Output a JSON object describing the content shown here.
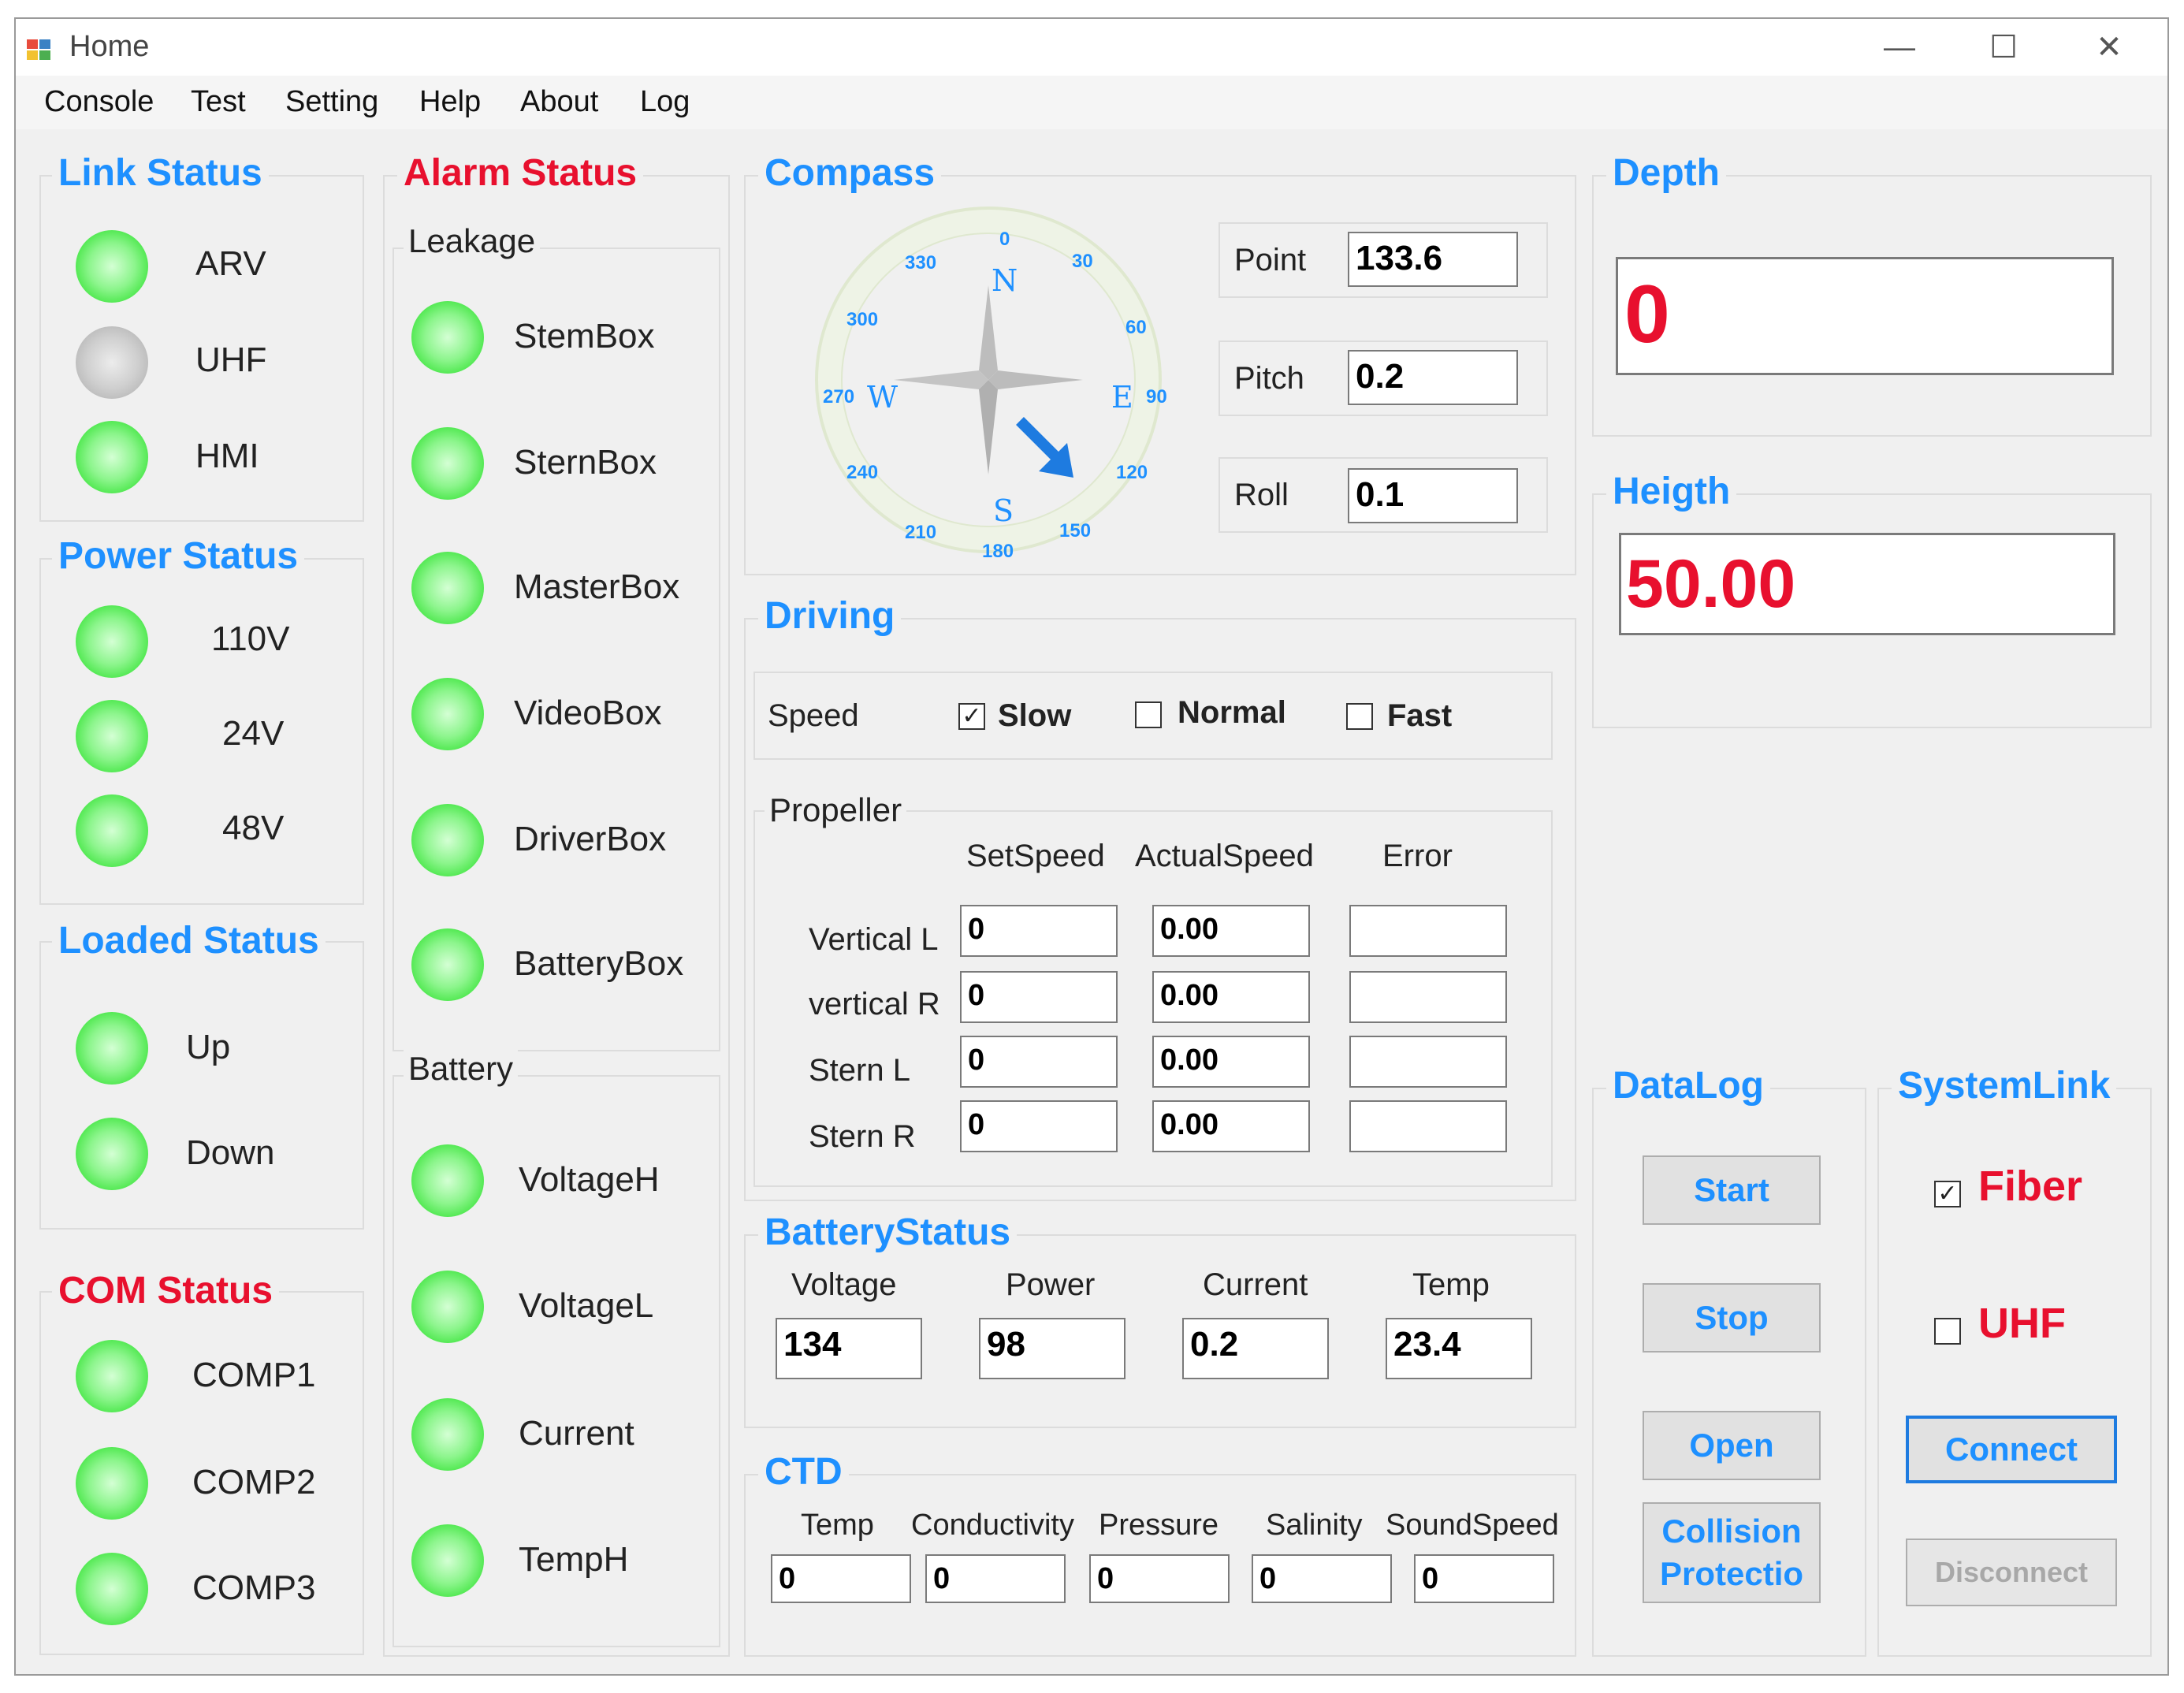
{
  "window": {
    "title": "Home"
  },
  "window_controls": {
    "minimize": "—",
    "maximize": "☐",
    "close": "✕"
  },
  "menu": [
    "Console",
    "Test",
    "Setting",
    "Help",
    "About",
    "Log"
  ],
  "link_status": {
    "title": "Link Status",
    "items": [
      "ARV",
      "UHF",
      "HMI"
    ]
  },
  "power_status": {
    "title": "Power Status",
    "items": [
      "110V",
      "24V",
      "48V"
    ]
  },
  "loaded_status": {
    "title": "Loaded Status",
    "items": [
      "Up",
      "Down"
    ]
  },
  "com_status": {
    "title": "COM Status",
    "items": [
      "COMP1",
      "COMP2",
      "COMP3"
    ]
  },
  "alarm_status": {
    "title": "Alarm Status",
    "leakage": {
      "title": "Leakage",
      "items": [
        "StemBox",
        "SternBox",
        "MasterBox",
        "VideoBox",
        "DriverBox",
        "BatteryBox"
      ]
    },
    "battery": {
      "title": "Battery",
      "items": [
        "VoltageH",
        "VoltageL",
        "Current",
        "TempH"
      ]
    }
  },
  "compass": {
    "title": "Compass",
    "ticks": [
      "0",
      "30",
      "60",
      "90",
      "120",
      "150",
      "180",
      "210",
      "240",
      "270",
      "300",
      "330"
    ],
    "cardinals": {
      "n": "N",
      "e": "E",
      "s": "S",
      "w": "W"
    },
    "point_label": "Point",
    "point_value": "133.6",
    "pitch_label": "Pitch",
    "pitch_value": "0.2",
    "roll_label": "Roll",
    "roll_value": "0.1"
  },
  "depth": {
    "title": "Depth",
    "value": "0"
  },
  "height": {
    "title": "Heigth",
    "value": "50.00"
  },
  "driving": {
    "title": "Driving",
    "speed_label": "Speed",
    "slow": "Slow",
    "normal": "Normal",
    "fast": "Fast",
    "check_mark": "✓",
    "propeller": {
      "title": "Propeller",
      "headers": [
        "SetSpeed",
        "ActualSpeed",
        "Error"
      ],
      "rows": [
        {
          "label": "Vertical L",
          "set": "0",
          "actual": "0.00",
          "error": ""
        },
        {
          "label": "vertical R",
          "set": "0",
          "actual": "0.00",
          "error": ""
        },
        {
          "label": "Stern L",
          "set": "0",
          "actual": "0.00",
          "error": ""
        },
        {
          "label": "Stern R",
          "set": "0",
          "actual": "0.00",
          "error": ""
        }
      ]
    }
  },
  "battery_status": {
    "title": "BatteryStatus",
    "fields": [
      {
        "label": "Voltage",
        "value": "134"
      },
      {
        "label": "Power",
        "value": "98"
      },
      {
        "label": "Current",
        "value": "0.2"
      },
      {
        "label": "Temp",
        "value": "23.4"
      }
    ]
  },
  "ctd": {
    "title": "CTD",
    "fields": [
      {
        "label": "Temp",
        "value": "0"
      },
      {
        "label": "Conductivity",
        "value": "0"
      },
      {
        "label": "Pressure",
        "value": "0"
      },
      {
        "label": "Salinity",
        "value": "0"
      },
      {
        "label": "SoundSpeed",
        "value": "0"
      }
    ]
  },
  "datalog": {
    "title": "DataLog",
    "start": "Start",
    "stop": "Stop",
    "open": "Open",
    "collision_line1": "Collision",
    "collision_line2": "Protectio"
  },
  "systemlink": {
    "title": "SystemLink",
    "fiber": "Fiber",
    "uhf": "UHF",
    "connect": "Connect",
    "disconnect": "Disconnect",
    "check_mark": "✓"
  },
  "colors": {
    "accent_blue": "#1e90ff",
    "alarm_red": "#e8102e",
    "led_green": "#45e645",
    "led_gray": "#b0b0b0"
  }
}
